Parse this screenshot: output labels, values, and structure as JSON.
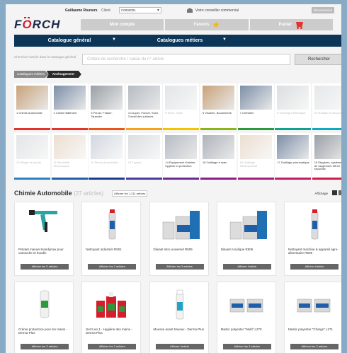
{
  "header": {
    "user_name": "Guillaume Rouvers",
    "client_label": "Client",
    "client_value": "C0000001",
    "consultant_label": "Votre conseiller commercial",
    "logout_label": "Déconnexion",
    "logo_text": "FÖRCH",
    "tabs": [
      {
        "label": "Mon compte"
      },
      {
        "label": "Favoris"
      },
      {
        "label": "Panier"
      }
    ]
  },
  "nav": {
    "items": [
      {
        "label": "Catalogue général"
      },
      {
        "label": "Catalogues métiers"
      }
    ]
  },
  "search": {
    "label": "Cherchez l'article dans le catalogue général",
    "placeholder": "Critère de recherche / saisie du n° article",
    "button_label": "Rechercher"
  },
  "breadcrumb": [
    "Catalogues métiers",
    "Aménagement"
  ],
  "categories": [
    {
      "label": "1 Chimie Automobile",
      "color": "#e3332a",
      "active": true
    },
    {
      "label": "2 Chimie Bâtiment",
      "color": "#e3332a",
      "active": true
    },
    {
      "label": "3 Percer, Fraiser, Tarauder",
      "color": "#e8561c",
      "active": true
    },
    {
      "label": "4 Couper, Poncer, Scier, Travail des surfaces",
      "color": "#f4a31a",
      "active": true
    },
    {
      "label": "5 Rivet, Vissé",
      "color": "#f2c500",
      "active": false
    },
    {
      "label": "6 Visserie, Boulonnerie",
      "color": "#8ab51a",
      "active": true
    },
    {
      "label": "7 Chevilles",
      "color": "#2a9a3c",
      "active": true
    },
    {
      "label": "8 Technique Électrique",
      "color": "#13a08c",
      "active": false
    },
    {
      "label": "9 Flexibles et raccords",
      "color": "#11a9c2",
      "active": false
    },
    {
      "label": "10 Sièges et liquide",
      "color": "#2d7fc2",
      "active": false
    },
    {
      "label": "11 Électricité, Électronique",
      "color": "#1f5ea8",
      "active": false
    },
    {
      "label": "12 Pièces Automobile",
      "color": "#1a3c8c",
      "active": false
    },
    {
      "label": "13 Tuyaux",
      "color": "#4a3c9a",
      "active": false
    },
    {
      "label": "14 Équipement d'atelier, hygiène et protection",
      "color": "#6a2a92",
      "active": true
    },
    {
      "label": "15 Outillage à main",
      "color": "#8a1e86",
      "active": true
    },
    {
      "label": "16 Outillage électroportatif",
      "color": "#a81c7a",
      "active": false
    },
    {
      "label": "17 Outillage pneumatique",
      "color": "#c41a6a",
      "active": true
    },
    {
      "label": "18 Étagères, systèmes de rangement MKIO, sécurités",
      "color": "#d41a4a",
      "active": true
    }
  ],
  "section": {
    "title": "Chimie Automobile",
    "count": "(27 articles)",
    "show_all_label": "Afficher les 1.211 articles",
    "display_label": "Affichage"
  },
  "products": [
    {
      "name": "Pistolet manuel Handymax pour cartouche et boudin",
      "button": "Afficher les 5 articles",
      "icon": "caulking-gun-icon"
    },
    {
      "name": "Nettoyant industriel R501",
      "button": "Afficher les 2 articles",
      "icon": "spray-can-icon"
    },
    {
      "name": "Diluant nitro universel R505",
      "button": "Afficher les 3 articles",
      "icon": "canister-icon"
    },
    {
      "name": "Diluant Acrylique R506",
      "button": "Afficher l'article",
      "icon": "canister-icon"
    },
    {
      "name": "Nettoyant machine & appareil agro-alimentaire R509",
      "button": "Afficher l'article",
      "icon": "spray-can-icon"
    },
    {
      "name": "Crème protectrice pour les mains - Derma Plus",
      "button": "Afficher les 3 articles",
      "icon": "cream-tube-icon"
    },
    {
      "name": "Set 5 en 1 - Hygiène des mains - Derma Plus",
      "button": "Afficher les 2 articles",
      "icon": "dispenser-icon"
    },
    {
      "name": "Mousse avant travaux - Derma Plus",
      "button": "Afficher l'article",
      "icon": "foam-bottle-icon"
    },
    {
      "name": "Mastic polyester \"Multi\" L270",
      "button": "Afficher les 3 articles",
      "icon": "paste-can-icon"
    },
    {
      "name": "Mastic polyester \"Charge\" L271",
      "button": "Afficher les 3 articles",
      "icon": "paste-can-icon"
    }
  ]
}
